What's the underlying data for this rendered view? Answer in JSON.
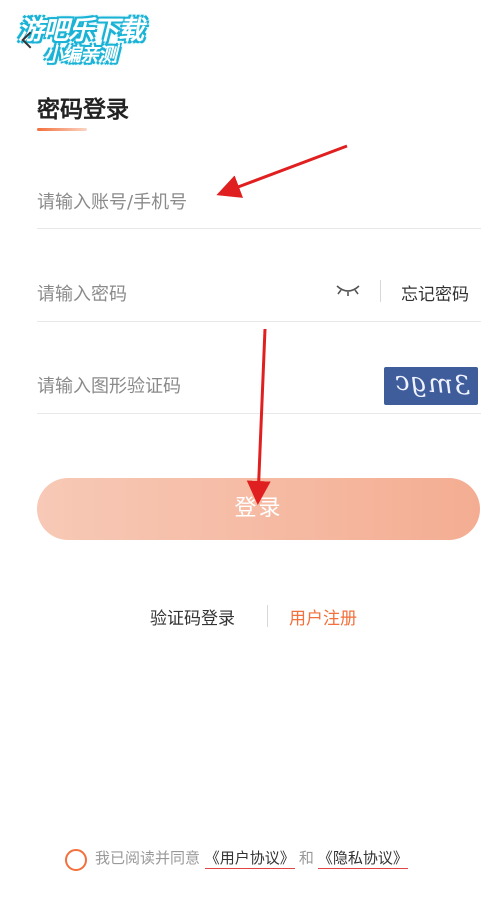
{
  "watermark": {
    "line1": "游吧乐下载",
    "line2": "小编亲测"
  },
  "header": {
    "back_icon": "chevron-left-icon",
    "title": "密码登录"
  },
  "form": {
    "account_placeholder": "请输入账号/手机号",
    "password_placeholder": "请输入密码",
    "password_visibility_icon": "eye-closed-icon",
    "forgot_password": "忘记密码",
    "captcha_placeholder": "请输入图形验证码",
    "captcha_text": "3mgc"
  },
  "actions": {
    "login_label": "登录",
    "sms_login_label": "验证码登录",
    "register_label": "用户注册"
  },
  "agreement": {
    "prefix": "我已阅读并同意",
    "user_agreement": "《用户协议》",
    "and": "和",
    "privacy_policy": "《隐私协议》"
  },
  "colors": {
    "accent": "#f36f3b",
    "button_gradient_start": "#f7c9b6",
    "button_gradient_end": "#f4ad92",
    "annotation_arrow": "#e02020"
  }
}
